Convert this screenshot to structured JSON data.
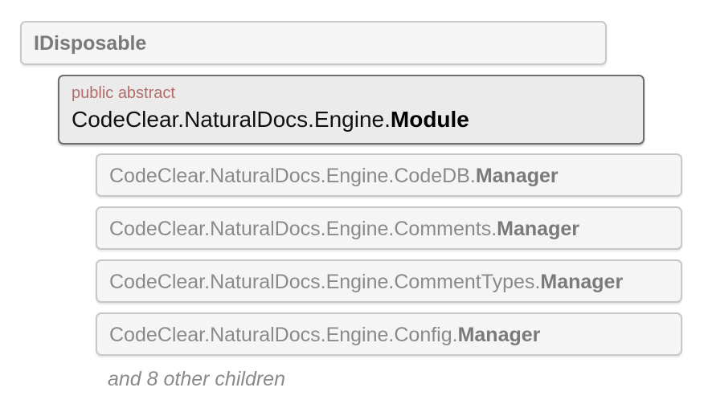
{
  "parent": {
    "name": "IDisposable"
  },
  "current": {
    "modifier": "public abstract",
    "namespace": "CodeClear.NaturalDocs.Engine.",
    "class": "Module"
  },
  "children": [
    {
      "namespace": "CodeClear.NaturalDocs.Engine.CodeDB.",
      "class": "Manager"
    },
    {
      "namespace": "CodeClear.NaturalDocs.Engine.Comments.",
      "class": "Manager"
    },
    {
      "namespace": "CodeClear.NaturalDocs.Engine.CommentTypes.",
      "class": "Manager"
    },
    {
      "namespace": "CodeClear.NaturalDocs.Engine.Config.",
      "class": "Manager"
    }
  ],
  "more_children": "and 8 other children"
}
